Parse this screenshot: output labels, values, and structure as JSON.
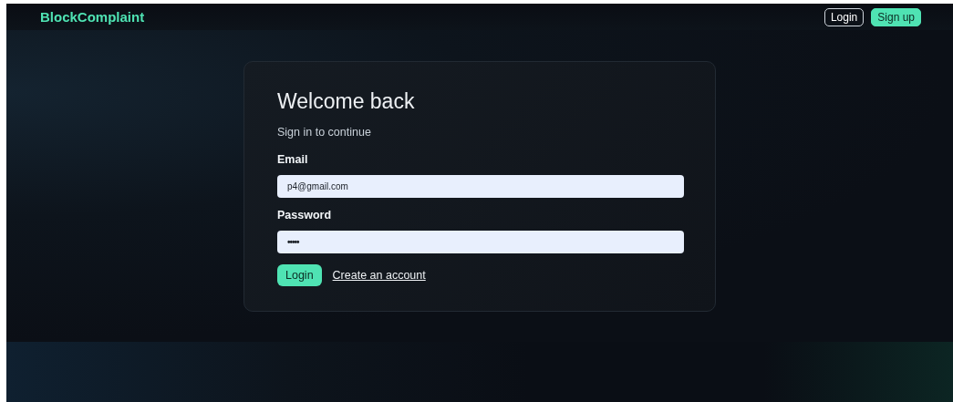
{
  "header": {
    "brand": "BlockComplaint",
    "buttons": [
      {
        "label": "Login",
        "kind": "outline"
      },
      {
        "label": "Sign up",
        "kind": "filled"
      }
    ]
  },
  "card": {
    "title": "Welcome back",
    "subtitle": "Sign in to continue",
    "fields": [
      {
        "label": "Email",
        "value": "p4@gmail.com",
        "kind": "text"
      },
      {
        "label": "Password",
        "value": "•••••",
        "kind": "password"
      }
    ],
    "submit": "Login",
    "link": "Create an account"
  }
}
